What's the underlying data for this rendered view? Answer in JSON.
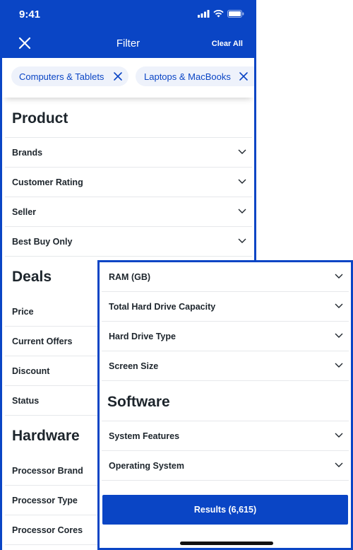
{
  "status_bar": {
    "time": "9:41"
  },
  "header": {
    "title": "Filter",
    "clear_all_label": "Clear All"
  },
  "chips": [
    {
      "label": "Computers & Tablets"
    },
    {
      "label": "Laptops & MacBooks"
    }
  ],
  "product": {
    "heading": "Product",
    "items": [
      "Brands",
      "Customer Rating",
      "Seller",
      "Best Buy Only"
    ]
  },
  "deals": {
    "heading": "Deals",
    "items": [
      "Price",
      "Current Offers",
      "Discount",
      "Status"
    ]
  },
  "hardware": {
    "heading": "Hardware",
    "items": [
      "Processor Brand",
      "Processor Type",
      "Processor Cores"
    ]
  },
  "overlay": {
    "hardware_items": [
      "RAM (GB)",
      "Total Hard Drive Capacity",
      "Hard Drive Type",
      "Screen Size"
    ],
    "software": {
      "heading": "Software",
      "items": [
        "System Features",
        "Operating System"
      ]
    },
    "results_label": "Results (6,615)"
  },
  "colors": {
    "brand_blue": "#0a45c5",
    "chip_bg": "#eef2fb",
    "text": "#1d252c"
  },
  "icons": [
    "close-icon",
    "chevron-down-icon",
    "signal-icon",
    "wifi-icon",
    "battery-icon"
  ]
}
